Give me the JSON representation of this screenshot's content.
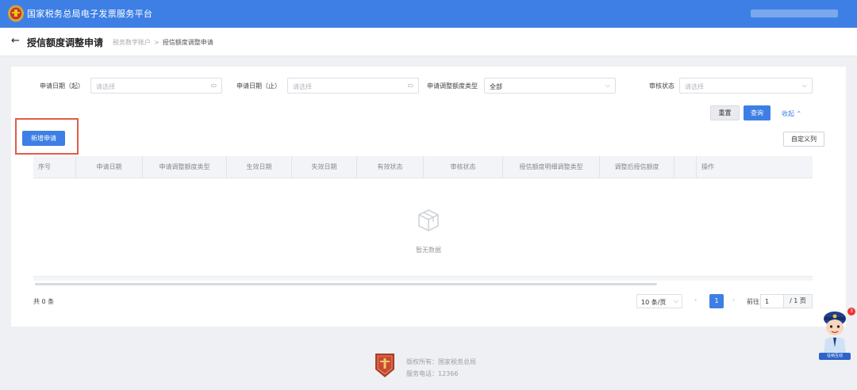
{
  "header": {
    "title": "国家税务总局电子发票服务平台"
  },
  "page": {
    "title": "授信额度调整申请",
    "breadcrumb": [
      "税务数字账户",
      "授信额度调整申请"
    ],
    "breadcrumb_sep": ">"
  },
  "filters": {
    "start_date_label": "申请日期（起）",
    "start_date_placeholder": "请选择",
    "end_date_label": "申请日期（止）",
    "end_date_placeholder": "请选择",
    "adjust_type_label": "申请调整额度类型",
    "adjust_type_value": "全部",
    "audit_status_label": "审核状态",
    "audit_status_placeholder": "请选择"
  },
  "actions": {
    "reset_label": "重置",
    "query_label": "查询",
    "collapse_label": "收起",
    "add_label": "新增申请",
    "custom_columns_label": "自定义列"
  },
  "table": {
    "columns": [
      "序号",
      "申请日期",
      "申请调整额度类型",
      "生效日期",
      "失效日期",
      "有效状态",
      "审核状态",
      "授信额度明细调整类型",
      "调整后授信额度",
      "",
      "操作"
    ],
    "empty_text": "暂无数据"
  },
  "pagination": {
    "total_text": "共 0 条",
    "page_size": "10 条/页",
    "current_page": "1",
    "prev": "‹",
    "next": "›",
    "jump_label": "前往",
    "jump_value": "1",
    "total_pages": "/ 1 页"
  },
  "footer": {
    "line1": "版权所有：国家税务总局",
    "line2": "服务电话：12366"
  },
  "assistant": {
    "badge": "3",
    "label": "征纳互动"
  },
  "colors": {
    "brand_blue": "#3d7fe4",
    "highlight_red": "#e25b4b"
  }
}
